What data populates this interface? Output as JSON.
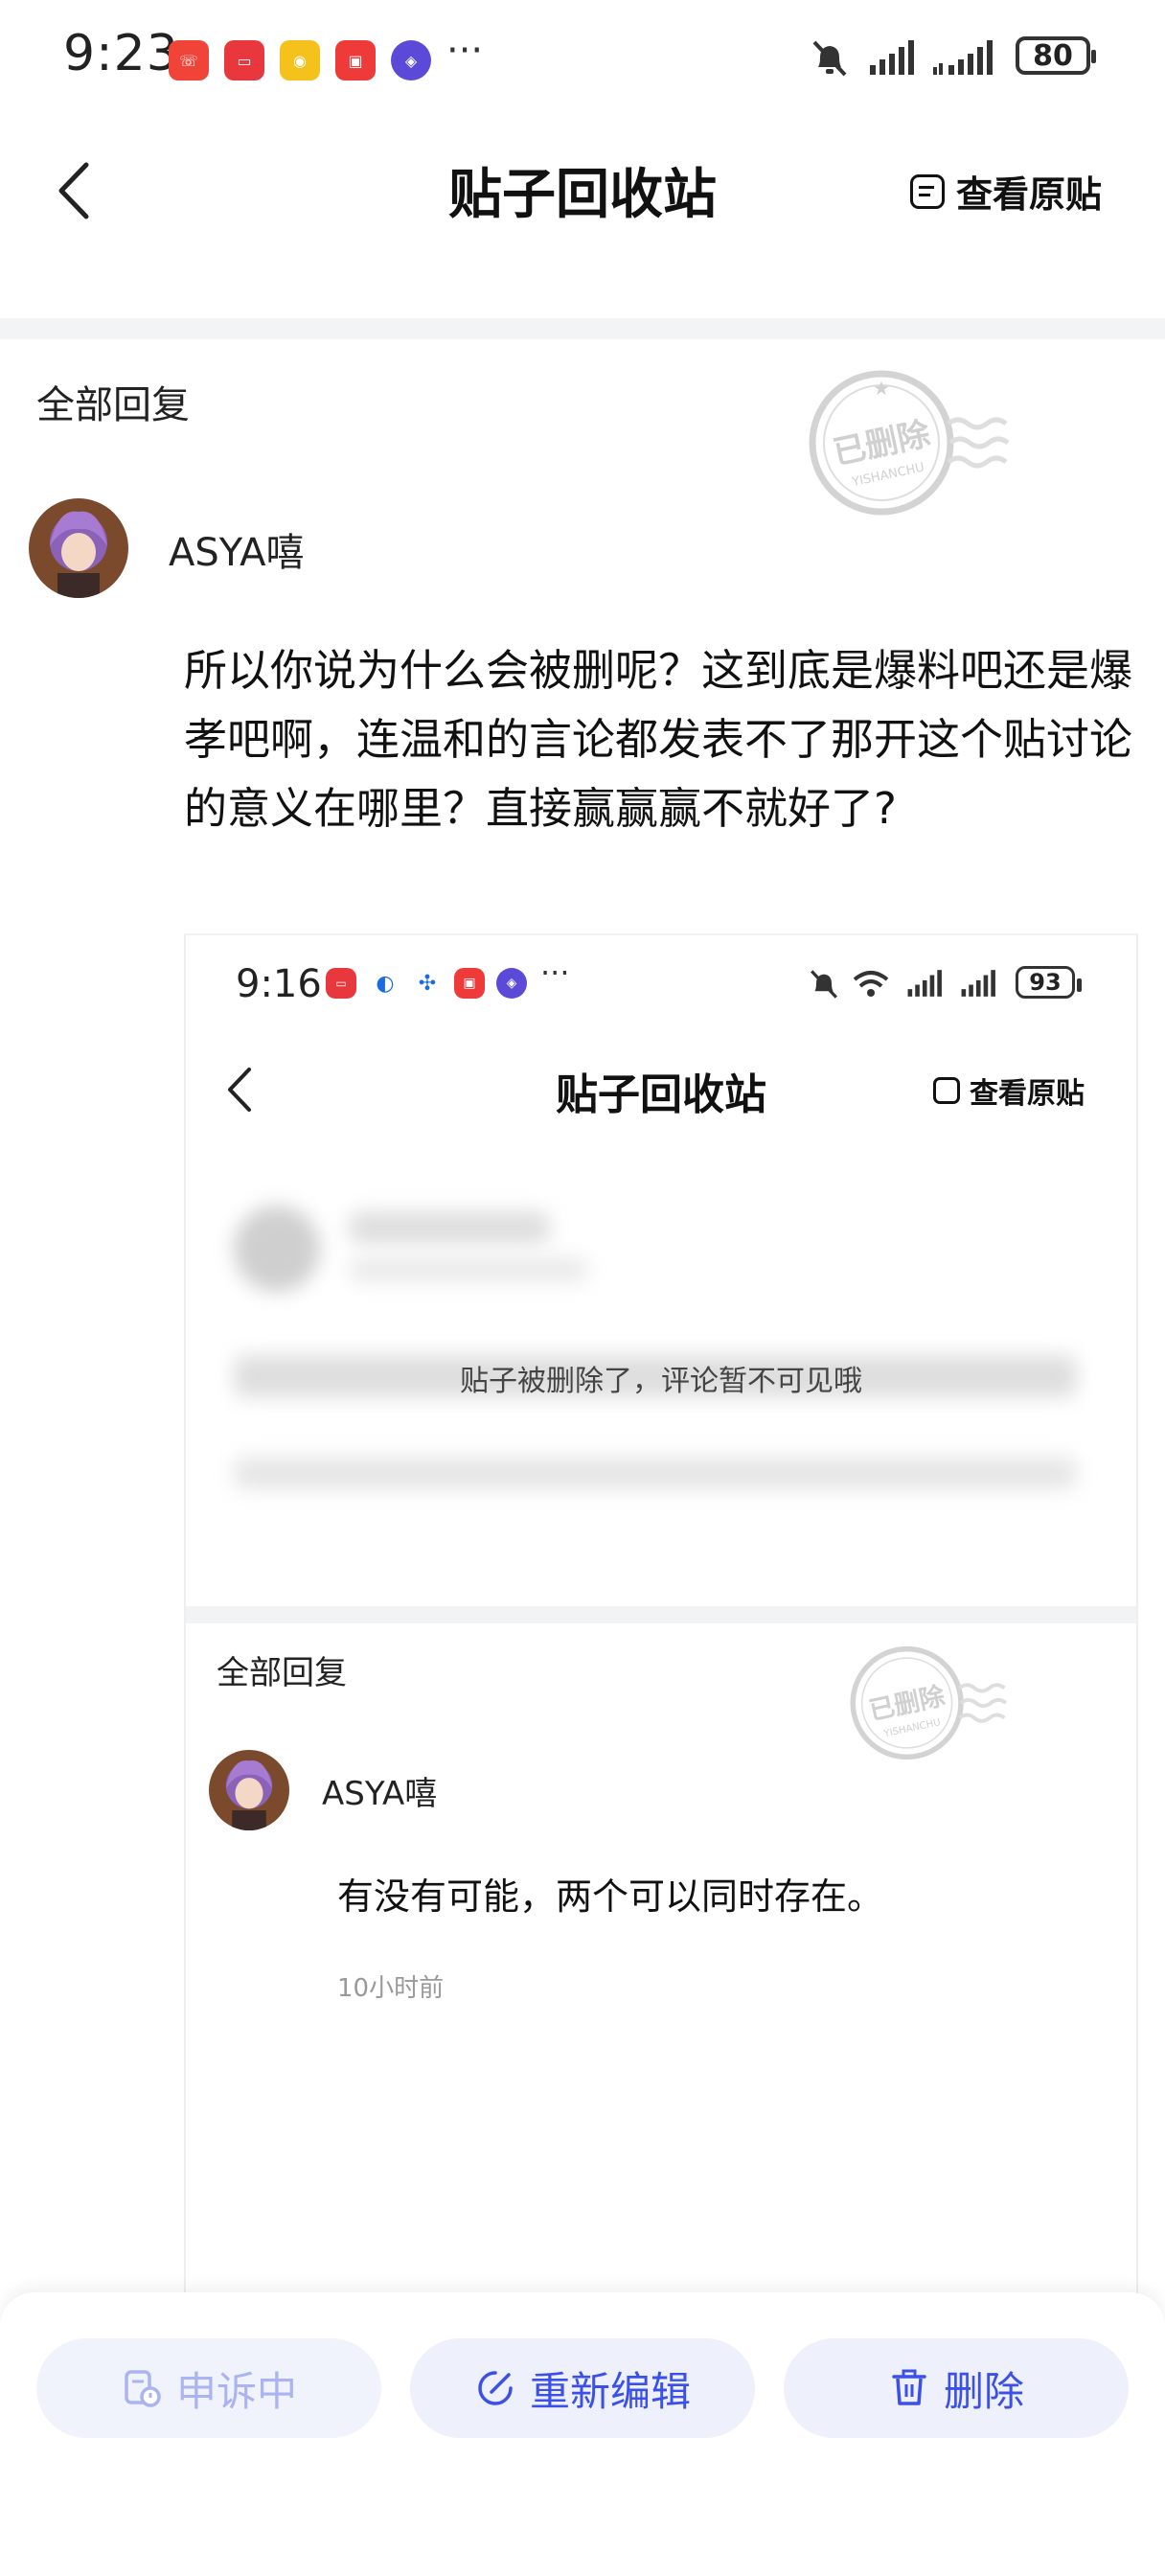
{
  "status_bar": {
    "time": "9:23",
    "battery": "80",
    "more": "···"
  },
  "nav": {
    "title": "贴子回收站",
    "view_original": "查看原贴"
  },
  "section": {
    "label": "全部回复"
  },
  "stamp": {
    "main": "已删除",
    "sub": "YISHANCHU"
  },
  "post": {
    "username": "ASYA嘻",
    "text": "所以你说为什么会被删呢？这到底是爆料吧还是爆孝吧啊，连温和的言论都发表不了那开这个贴讨论的意义在哪里？直接赢赢赢不就好了?"
  },
  "embedded": {
    "status_time": "9:16",
    "battery": "93",
    "more": "···",
    "title": "贴子回收站",
    "view_original": "查看原贴",
    "deleted_notice": "贴子被删除了，评论暂不可见哦",
    "section_label": "全部回复",
    "stamp_main": "已删除",
    "stamp_sub": "YISHANCHU",
    "username": "ASYA嘻",
    "reply_text": "有没有可能，两个可以同时存在。",
    "reply_time": "10小时前"
  },
  "actions": {
    "appeal": "申诉中",
    "reedit": "重新编辑",
    "delete": "删除"
  },
  "colors": {
    "accent": "#3b50e8",
    "button_bg": "#eef0fb"
  }
}
